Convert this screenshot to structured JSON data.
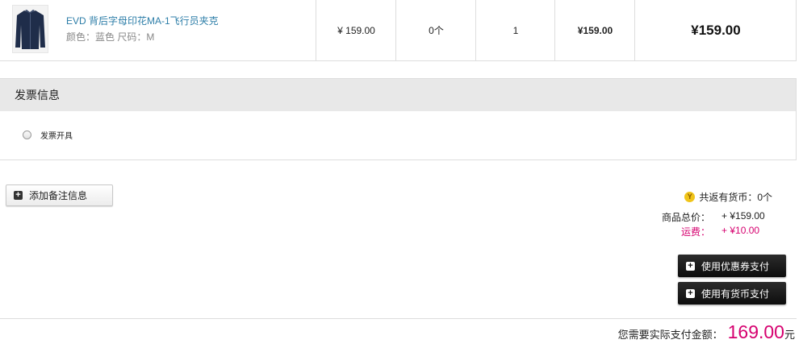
{
  "product": {
    "name": "EVD 背后字母印花MA-1飞行员夹克",
    "attributes": "颜色：蓝色 尺码：M",
    "unit_price": "¥ 159.00",
    "coin_return": "0个",
    "quantity": "1",
    "subtotal": "¥159.00",
    "total": "¥159.00"
  },
  "invoice": {
    "title": "发票信息",
    "option_label": "发票开具"
  },
  "remark": {
    "button_label": "添加备注信息"
  },
  "summary": {
    "coins_text": "共返有货币：0个",
    "coin_glyph": "Y",
    "goods_total_label": "商品总价：",
    "goods_total_value": "+ ¥159.00",
    "shipping_label": "运费：",
    "shipping_value": "+ ¥10.00"
  },
  "actions": {
    "coupon_button": "使用优惠券支付",
    "coin_button": "使用有货币支付"
  },
  "payment": {
    "label": "您需要实际支付金额：",
    "amount": "169.00",
    "unit": "元"
  },
  "colors": {
    "link": "#2d7ea8",
    "accent": "#d6006f"
  }
}
